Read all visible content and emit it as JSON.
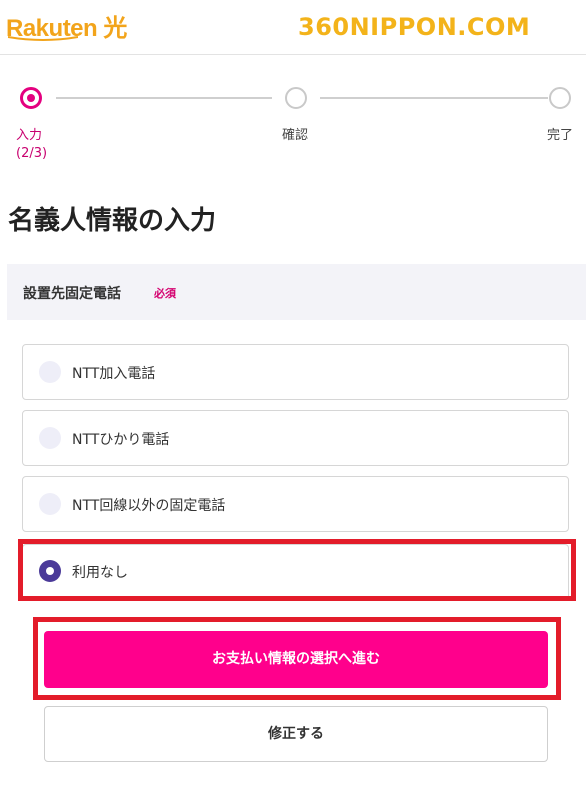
{
  "header": {
    "logo_text": "Rakuten 光",
    "watermark": "360NIPPON.COM"
  },
  "stepper": {
    "steps": [
      {
        "label": "入力",
        "sublabel": "(2/3)",
        "state": "active"
      },
      {
        "label": "確認",
        "state": "pending"
      },
      {
        "label": "完了",
        "state": "pending"
      }
    ]
  },
  "page_title": "名義人情報の入力",
  "section": {
    "label": "設置先固定電話",
    "required_badge": "必須"
  },
  "options": [
    {
      "label": "NTT加入電話",
      "selected": false
    },
    {
      "label": "NTTひかり電話",
      "selected": false
    },
    {
      "label": "NTT回線以外の固定電話",
      "selected": false
    },
    {
      "label": "利用なし",
      "selected": true
    }
  ],
  "buttons": {
    "primary": "お支払い情報の選択へ進む",
    "secondary": "修正する"
  },
  "colors": {
    "accent": "#e4007f",
    "primary_button": "#ff008c",
    "radio_checked": "#4b3a99",
    "highlight": "#e31c2a",
    "logo": "#f2a41b"
  }
}
